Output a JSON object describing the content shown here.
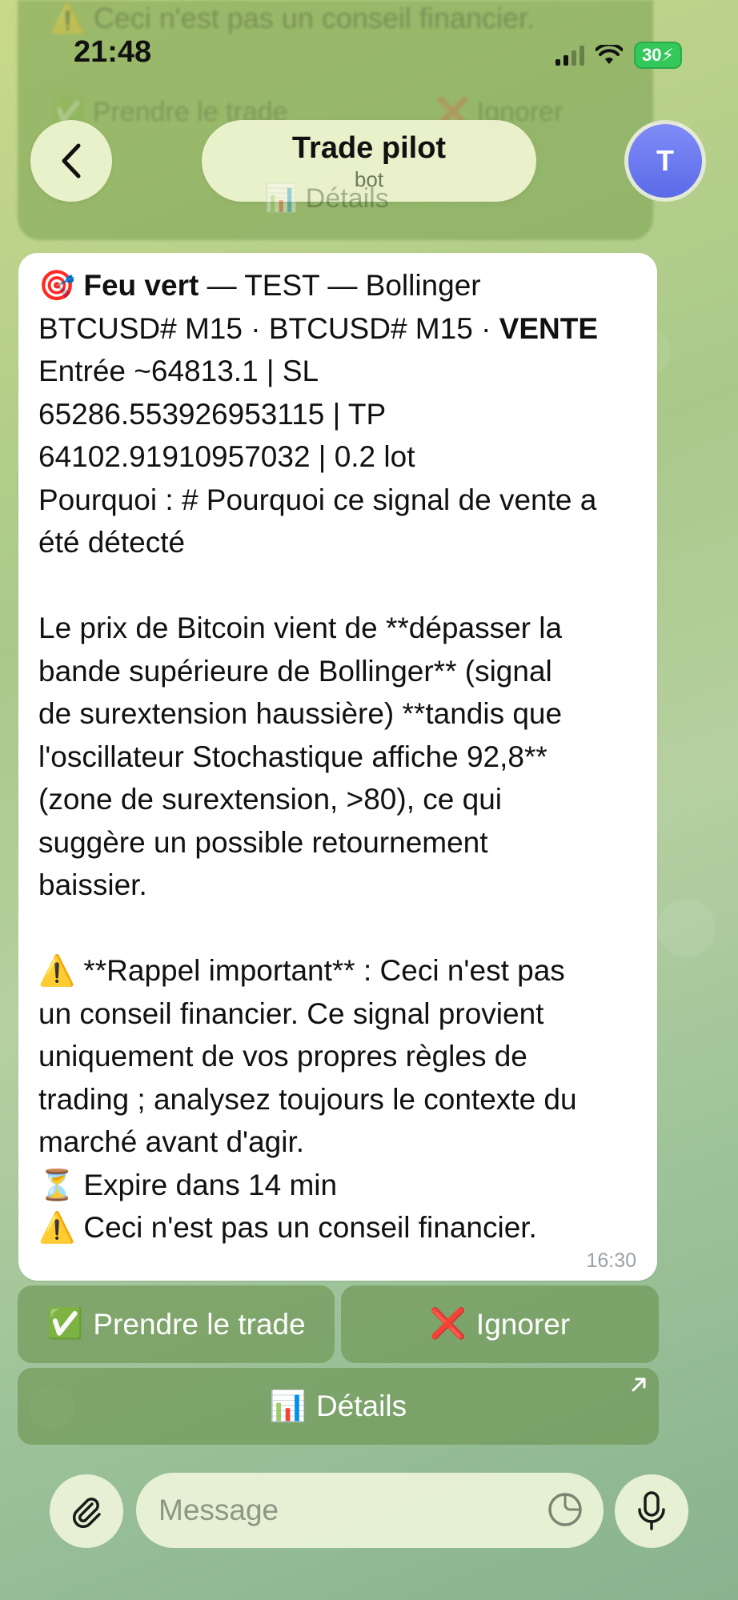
{
  "status_bar": {
    "time": "21:48",
    "battery": "30"
  },
  "header": {
    "title": "Trade pilot",
    "subtitle": "bot",
    "avatar_initial": "T"
  },
  "ghost": {
    "warning_text": "⚠️ Ceci n'est pas un conseil financier.",
    "take_label": "✅ Prendre le trade",
    "ignore_label": "❌ Ignorer",
    "details_label": "📊 Détails"
  },
  "message": {
    "lead_emoji": "🎯",
    "lead_bold": "Feu vert",
    "line1_rest": " — TEST — Bollinger",
    "line2_prefix": "BTCUSD# M15 · BTCUSD# M15 · ",
    "line2_bold": "VENTE",
    "body": "Entrée ~64813.1 | SL\n65286.553926953115 | TP\n64102.91910957032 | 0.2 lot\nPourquoi : # Pourquoi ce signal de vente a\nété détecté\n\nLe prix de Bitcoin vient de **dépasser la\nbande supérieure de Bollinger** (signal\nde surextension haussière) **tandis que\nl'oscillateur Stochastique affiche 92,8**\n(zone de surextension, >80), ce qui\nsuggère un possible retournement\nbaissier.\n\n⚠️ **Rappel important** : Ceci n'est pas\nun conseil financier. Ce signal provient\nuniquement de vos propres règles de\ntrading ; analysez toujours le contexte du\nmarché avant d'agir.\n⏳ Expire dans 14 min\n⚠️ Ceci n'est pas un conseil financier.",
    "time": "16:30"
  },
  "keyboard": {
    "take": {
      "emoji": "✅",
      "label": "Prendre le trade"
    },
    "ignore": {
      "emoji": "❌",
      "label": "Ignorer"
    },
    "details": {
      "emoji": "📊",
      "label": "Détails"
    }
  },
  "composer": {
    "placeholder": "Message"
  }
}
